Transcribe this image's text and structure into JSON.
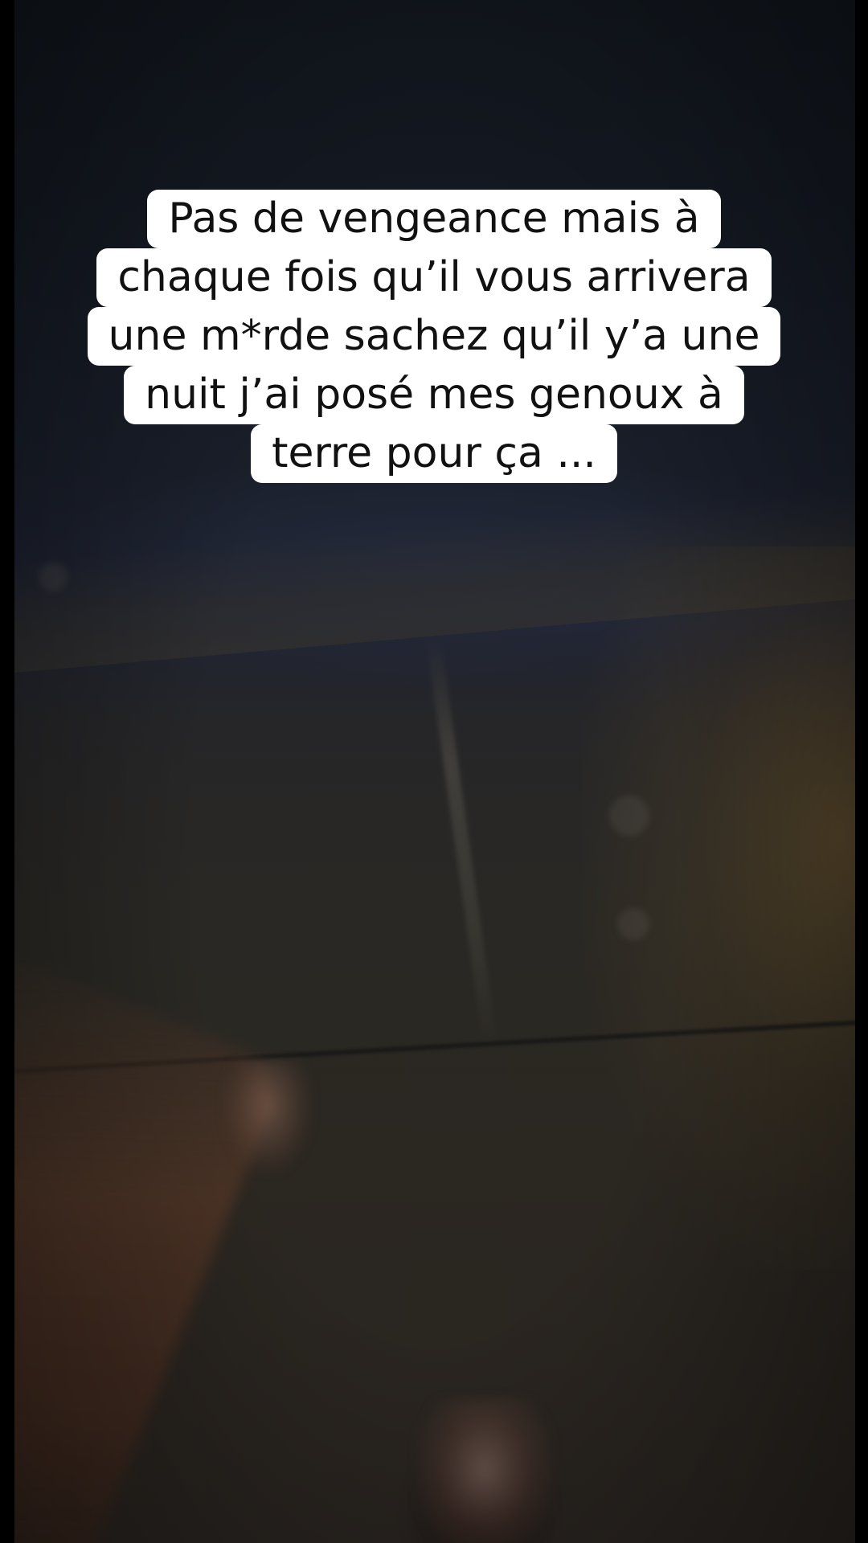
{
  "caption": {
    "lines": [
      "Pas de vengeance mais à",
      "chaque fois qu’il vous arrivera",
      "une m*rde sachez qu’il y’a une",
      "nuit j’ai posé mes genoux à",
      "terre pour ça ..."
    ]
  },
  "scene": {
    "description_colors": {
      "sky": "#171c27",
      "wall": "#2a2824",
      "warm_light": "#785c2c",
      "caption_bg": "#ffffff",
      "caption_text": "#111111"
    }
  }
}
